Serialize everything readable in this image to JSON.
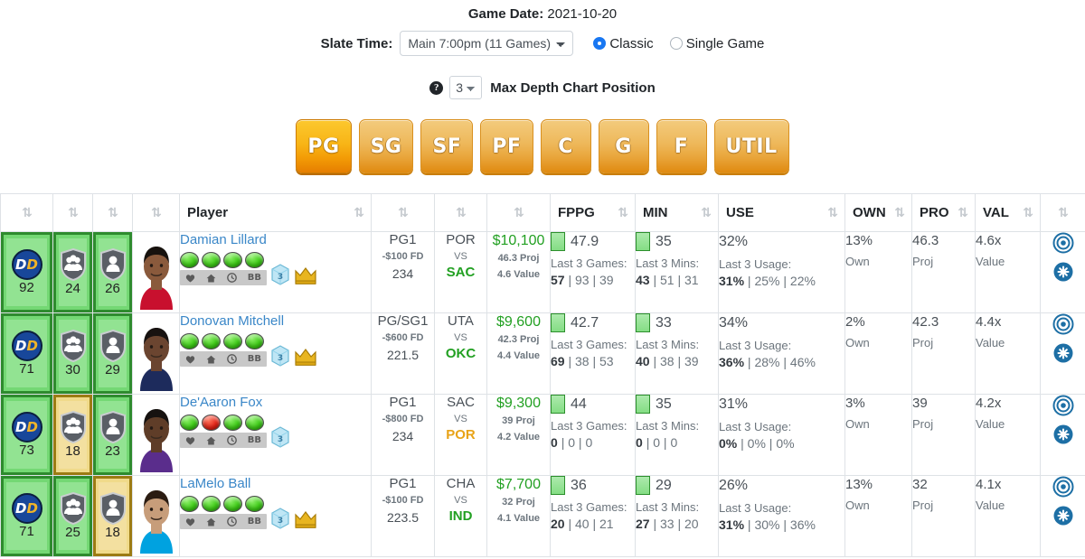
{
  "header": {
    "game_date_label": "Game Date:",
    "game_date_value": "2021-10-20",
    "slate_time_label": "Slate Time:",
    "slate_time_value": "Main 7:00pm (11 Games)",
    "contest_type_classic": "Classic",
    "contest_type_single": "Single Game",
    "contest_type_selected": "Classic",
    "help_glyph": "?",
    "depth_value": "3",
    "depth_label": "Max Depth Chart Position"
  },
  "positions": {
    "selected": "PG",
    "buttons": [
      "PG",
      "SG",
      "SF",
      "PF",
      "C",
      "G",
      "F",
      "UTIL"
    ]
  },
  "table": {
    "sort_glyph": "⇅",
    "headers": [
      {
        "label": "",
        "sortable": true
      },
      {
        "label": "",
        "sortable": true
      },
      {
        "label": "",
        "sortable": true
      },
      {
        "label": "",
        "sortable": true
      },
      {
        "label": "Player",
        "sortable": true
      },
      {
        "label": "",
        "sortable": true
      },
      {
        "label": "",
        "sortable": true
      },
      {
        "label": "",
        "sortable": true
      },
      {
        "label": "FPPG",
        "sortable": true
      },
      {
        "label": "MIN",
        "sortable": true
      },
      {
        "label": "USE",
        "sortable": true
      },
      {
        "label": "OWN",
        "sortable": true
      },
      {
        "label": "PRO",
        "sortable": true
      },
      {
        "label": "VAL",
        "sortable": true
      },
      {
        "label": "",
        "sortable": true
      }
    ],
    "labels": {
      "last3games": "Last 3 Games:",
      "last3mins": "Last 3 Mins:",
      "last3usage": "Last 3 Usage:",
      "own": "Own",
      "proj": "Proj",
      "value": "Value",
      "vs": "VS",
      "dd": "DD"
    },
    "rows": [
      {
        "dd_score": "92",
        "dd_tone": "green",
        "team_score": "24",
        "team_tone": "green",
        "player_score": "26",
        "player_tone": "green",
        "name": "Damian Lillard",
        "leds": [
          "g",
          "g",
          "g",
          "g"
        ],
        "mini_icons": [
          "heart",
          "home",
          "clock",
          "BB"
        ],
        "has_ice": true,
        "has_crown": true,
        "pos": "PG1",
        "salary_delta": "-$100 FD",
        "total": "234",
        "team": "POR",
        "opponent": "SAC",
        "opponent_tone": "green",
        "salary": "$10,100",
        "proj_sub": "46.3 Proj",
        "value_sub": "4.6 Value",
        "fppg": "47.9",
        "fppg_last3": [
          "57",
          "93",
          "39"
        ],
        "min": "35",
        "min_last3": [
          "43",
          "51",
          "31"
        ],
        "use": "32%",
        "use_last3": [
          "31%",
          "25%",
          "22%"
        ],
        "own": "13%",
        "pro": "46.3",
        "val": "4.6x"
      },
      {
        "dd_score": "71",
        "dd_tone": "green",
        "team_score": "30",
        "team_tone": "green",
        "player_score": "29",
        "player_tone": "green",
        "name": "Donovan Mitchell",
        "leds": [
          "g",
          "g",
          "g",
          "g"
        ],
        "mini_icons": [
          "heart",
          "home",
          "clock",
          "BB"
        ],
        "has_ice": true,
        "has_crown": true,
        "pos": "PG/SG1",
        "salary_delta": "-$600 FD",
        "total": "221.5",
        "team": "UTA",
        "opponent": "OKC",
        "opponent_tone": "green",
        "salary": "$9,600",
        "proj_sub": "42.3 Proj",
        "value_sub": "4.4 Value",
        "fppg": "42.7",
        "fppg_last3": [
          "69",
          "38",
          "53"
        ],
        "min": "33",
        "min_last3": [
          "40",
          "38",
          "39"
        ],
        "use": "34%",
        "use_last3": [
          "36%",
          "28%",
          "46%"
        ],
        "own": "2%",
        "pro": "42.3",
        "val": "4.4x"
      },
      {
        "dd_score": "73",
        "dd_tone": "green",
        "team_score": "18",
        "team_tone": "gold",
        "player_score": "23",
        "player_tone": "green",
        "name": "De'Aaron Fox",
        "leds": [
          "g",
          "r",
          "g",
          "g"
        ],
        "mini_icons": [
          "heart",
          "home",
          "clock",
          "BB"
        ],
        "has_ice": true,
        "has_crown": false,
        "pos": "PG1",
        "salary_delta": "-$800 FD",
        "total": "234",
        "team": "SAC",
        "opponent": "POR",
        "opponent_tone": "gold",
        "salary": "$9,300",
        "proj_sub": "39 Proj",
        "value_sub": "4.2 Value",
        "fppg": "44",
        "fppg_last3": [
          "0",
          "0",
          "0"
        ],
        "min": "35",
        "min_last3": [
          "0",
          "0",
          "0"
        ],
        "use": "31%",
        "use_last3": [
          "0%",
          "0%",
          "0%"
        ],
        "own": "3%",
        "pro": "39",
        "val": "4.2x"
      },
      {
        "dd_score": "71",
        "dd_tone": "green",
        "team_score": "25",
        "team_tone": "green",
        "player_score": "18",
        "player_tone": "gold",
        "name": "LaMelo Ball",
        "leds": [
          "g",
          "g",
          "g",
          "g"
        ],
        "mini_icons": [
          "heart",
          "home",
          "clock",
          "BB"
        ],
        "has_ice": true,
        "has_crown": true,
        "pos": "PG1",
        "salary_delta": "-$100 FD",
        "total": "223.5",
        "team": "CHA",
        "opponent": "IND",
        "opponent_tone": "green",
        "salary": "$7,700",
        "proj_sub": "32 Proj",
        "value_sub": "4.1 Value",
        "fppg": "36",
        "fppg_last3": [
          "20",
          "40",
          "21"
        ],
        "min": "29",
        "min_last3": [
          "27",
          "33",
          "20"
        ],
        "use": "26%",
        "use_last3": [
          "31%",
          "30%",
          "36%"
        ],
        "own": "13%",
        "pro": "32",
        "val": "4.1x"
      }
    ]
  },
  "colors": {
    "accent_orange": "#f3a01a",
    "link_blue": "#3a87c8",
    "green": "#22a022",
    "gold": "#e8a317",
    "badge_green": "#92e392",
    "badge_gold": "#f3e0a0"
  }
}
